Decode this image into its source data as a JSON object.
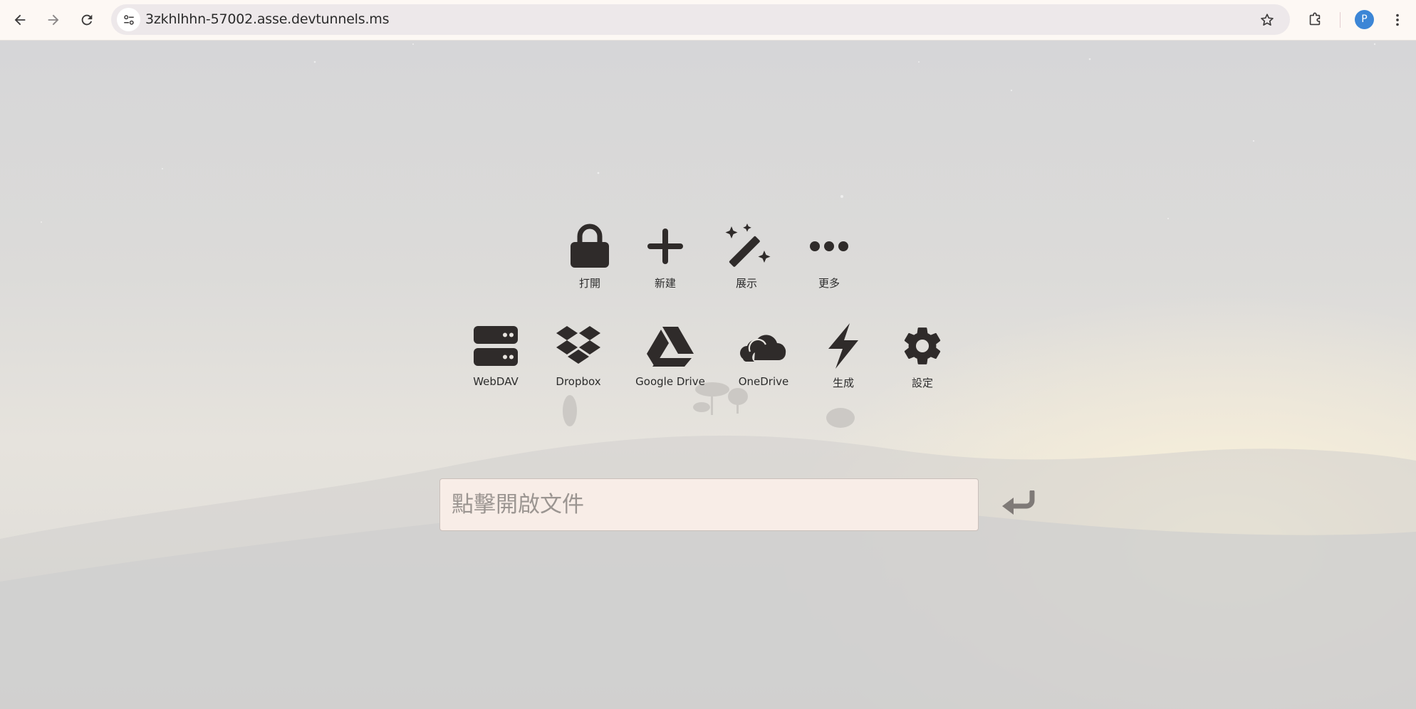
{
  "browser": {
    "url": "3zkhlhhn-57002.asse.devtunnels.ms",
    "profile_initial": "P"
  },
  "launcher": {
    "row1": [
      {
        "label": "打開",
        "icon": "lock-icon"
      },
      {
        "label": "新建",
        "icon": "plus-icon"
      },
      {
        "label": "展示",
        "icon": "magic-wand-icon"
      },
      {
        "label": "更多",
        "icon": "ellipsis-icon"
      }
    ],
    "row2": [
      {
        "label": "WebDAV",
        "icon": "server-icon"
      },
      {
        "label": "Dropbox",
        "icon": "dropbox-icon"
      },
      {
        "label": "Google Drive",
        "icon": "google-drive-icon"
      },
      {
        "label": "OneDrive",
        "icon": "onedrive-icon"
      },
      {
        "label": "生成",
        "icon": "lightning-icon"
      },
      {
        "label": "設定",
        "icon": "gear-icon"
      }
    ]
  },
  "open_input": {
    "placeholder": "點擊開啟文件",
    "value": ""
  },
  "colors": {
    "icon": "#2f2b2a",
    "chrome_bg": "#fdf8f4",
    "omnibox_bg": "#ede8ea",
    "avatar": "#3c86d6"
  }
}
